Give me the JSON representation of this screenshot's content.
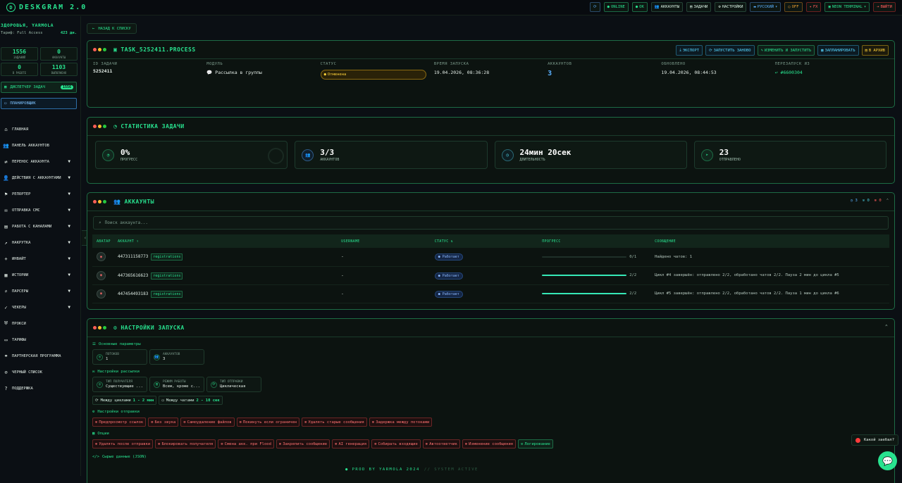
{
  "app": {
    "logo_letter": "D",
    "title": "DESKGRAM 2.0"
  },
  "topbar": {
    "refresh_icon": "refresh-icon",
    "online": "ONLINE",
    "ok": "OK",
    "accounts": "АККАУНТЫ",
    "tasks": "ЗАДАЧИ",
    "settings": "НАСТРОЙКИ",
    "language": "РУССКИЙ",
    "off": "OFF",
    "fx": "FX",
    "theme": "NEON TERMINAL",
    "logout": "ВЫЙТИ"
  },
  "sidebar": {
    "greeting": "ЗДОРОВЬЯ, YARMOLA",
    "tarif": "Тариф: Full Access",
    "days": "423 дн.",
    "stats": [
      {
        "value": "1556",
        "label": "ЗАДАНИЙ"
      },
      {
        "value": "0",
        "label": "АККАУНТЫ"
      },
      {
        "value": "0",
        "label": "В РАБОТЕ"
      },
      {
        "value": "1103",
        "label": "ВЫПОЛНЕНО"
      }
    ],
    "dispatcher": "ДИСПЕТЧЕР ЗАДАЧ",
    "dispatcher_count": "1556",
    "planner": "ПЛАНИРОВЩИК",
    "nav": [
      {
        "label": "ГЛАВНАЯ",
        "icon": "home-icon",
        "chev": false
      },
      {
        "label": "ПАНЕЛЬ АККАУНТОВ",
        "icon": "users-icon",
        "chev": false
      },
      {
        "label": "ПЕРЕНОС АККАУНТА",
        "icon": "transfer-icon",
        "chev": true
      },
      {
        "label": "ДЕЙСТВИЯ С АККАУНТАМИ",
        "icon": "user-action-icon",
        "chev": true
      },
      {
        "label": "РЕПОРТЕР",
        "icon": "flag-icon",
        "chev": true
      },
      {
        "label": "ОТПРАВКА СМС",
        "icon": "message-icon",
        "chev": true
      },
      {
        "label": "РАБОТА С КАНАЛАМИ",
        "icon": "channel-icon",
        "chev": true
      },
      {
        "label": "НАКРУТКА",
        "icon": "chart-icon",
        "chev": true
      },
      {
        "label": "ИНВАЙТ",
        "icon": "invite-icon",
        "chev": true
      },
      {
        "label": "ИСТОРИИ",
        "icon": "story-icon",
        "chev": true
      },
      {
        "label": "ПАРСЕРЫ",
        "icon": "search-icon",
        "chev": true
      },
      {
        "label": "ЧЕКЕРЫ",
        "icon": "check-icon",
        "chev": true
      },
      {
        "label": "ПРОКСИ",
        "icon": "shield-icon",
        "chev": false
      },
      {
        "label": "ТАРИФЫ",
        "icon": "tariff-icon",
        "chev": false
      },
      {
        "label": "ПАРТНЕРСКАЯ ПРОГРАММА",
        "icon": "partner-icon",
        "chev": false
      },
      {
        "label": "ЧЕРНЫЙ СПИСОК",
        "icon": "blacklist-icon",
        "chev": false
      },
      {
        "label": "ПОДДЕРЖКА",
        "icon": "support-icon",
        "chev": false
      }
    ]
  },
  "back": "НАЗАД К СПИСКУ",
  "task": {
    "title": "TASK_5252411.PROCESS",
    "actions": [
      "ЭКСПОРТ",
      "ЗАПУСТИТЬ ЗАНОВО",
      "ИЗМЕНИТЬ И ЗАПУСТИТЬ",
      "ЗАПЛАНИРОВАТЬ",
      "В АРХИВ"
    ],
    "labels": {
      "id": "ID ЗАДАЧИ",
      "module": "МОДУЛЬ",
      "status": "СТАТУС",
      "start": "ВРЕМЯ ЗАПУСКА",
      "accounts": "АККАУНТОВ",
      "updated": "ОБНОВЛЕНО",
      "restart": "ПЕРЕЗАПУСК ИЗ"
    },
    "id": "5252411",
    "module": "Рассылка в группы",
    "status": "Отменена",
    "start": "19.04.2026, 08:36:28",
    "accounts": "3",
    "updated": "19.04.2026, 08:44:53",
    "restart": "#6600304"
  },
  "stats_panel": {
    "title": "СТАТИСТИКА ЗАДАЧИ",
    "cards": [
      {
        "value": "0%",
        "label": "ПРОГРЕСС"
      },
      {
        "value": "3/3",
        "label": "АККАУНТОВ"
      },
      {
        "value": "24мин 20сек",
        "label": "ДЛИТЕЛЬНОСТЬ"
      },
      {
        "value": "23",
        "label": "ОТПРАВЛЕНО"
      }
    ]
  },
  "accounts_panel": {
    "title": "АККАУНТЫ",
    "counts": {
      "a": "3",
      "b": "0",
      "c": "0"
    },
    "search_placeholder": "Поиск аккаунта...",
    "columns": [
      "АВАТАР",
      "АККАУНТ ↑",
      "USERNAME",
      "СТАТУС ⇅",
      "ПРОГРЕСС",
      "СООБЩЕНИЕ"
    ],
    "rows": [
      {
        "phone": "447311158773",
        "tag": "registrations",
        "username": "-",
        "status": "● Работает",
        "progress": 0,
        "progress_label": "0/1",
        "message": "Найдено чатов: 1"
      },
      {
        "phone": "447365616623",
        "tag": "registrations",
        "username": "-",
        "status": "● Работает",
        "progress": 1,
        "progress_label": "2/2",
        "message": "Цикл #4 завершён: отправлено 2/2, обработано чатов 2/2. Пауза 2 мин до цикла #5"
      },
      {
        "phone": "447454493183",
        "tag": "registrations",
        "username": "-",
        "status": "● Работает",
        "progress": 1,
        "progress_label": "2/2",
        "message": "Цикл #5 завершён: отправлено 2/2, обработано чатов 2/2. Пауза 1 мин до цикла #6"
      }
    ]
  },
  "launch_panel": {
    "title": "НАСТРОЙКИ ЗАПУСКА",
    "basic": "Основные параметры",
    "threads_lbl": "ПОТОКОВ",
    "threads": "1",
    "accounts_lbl": "АККАУНТОВ",
    "accounts": "3",
    "mailing": "Настройки рассылки",
    "recipient_lbl": "ТИП ПОЛУЧАТЕЛЯ",
    "recipient": "Существующие ...",
    "mode_lbl": "РЕЖИМ РАБОТЫ",
    "mode": "Всем, кроме с...",
    "send_type_lbl": "ТИП ОТПРАВКИ",
    "send_type": "Циклическая",
    "between_cycles": "Между циклами",
    "cycles_val": "1 - 2 мин",
    "between_chats": "Между чатами",
    "chats_val": "2 - 10 сек",
    "send_settings": "Настройки отправки",
    "send_flags": [
      "Предпросмотр ссылок",
      "Без звука",
      "Самоудаление файлов",
      "Покинуть если ограничен",
      "Удалять старые сообщения",
      "Задержка между потоками"
    ],
    "options": "Опции",
    "option_flags": [
      {
        "label": "Удалять после отправки",
        "on": false
      },
      {
        "label": "Блокировать получателя",
        "on": false
      },
      {
        "label": "Смена акк. при Flood",
        "on": false
      },
      {
        "label": "Закрепить сообщение",
        "on": false
      },
      {
        "label": "AI генерация",
        "on": false
      },
      {
        "label": "Собирать входящие",
        "on": false
      },
      {
        "label": "Автоответчик",
        "on": false
      },
      {
        "label": "Изменение сообщения",
        "on": false
      },
      {
        "label": "Логирование",
        "on": true
      }
    ],
    "raw": "Сырые данные (JSON)"
  },
  "footer": {
    "left": "● PROD BY YARMOLA 2024",
    "right": "// SYSTEM ACTIVE"
  },
  "toast": "Какой заебал?",
  "colors": {
    "accent": "#28e28f",
    "bg": "#0b0f14",
    "danger": "#ff5a5a",
    "warn": "#ffd23a"
  }
}
